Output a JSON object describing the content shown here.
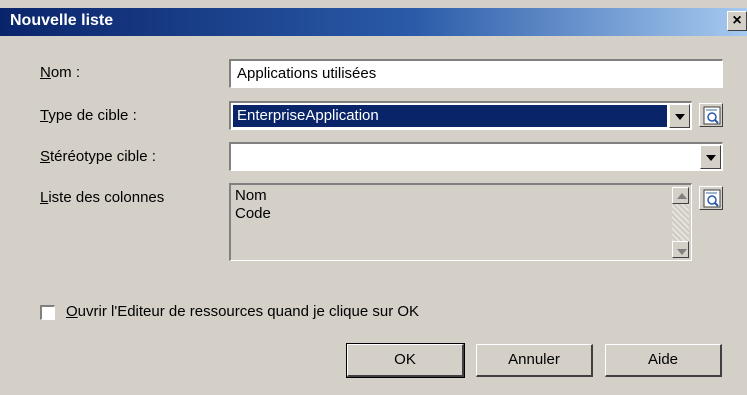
{
  "window": {
    "title": "Nouvelle liste",
    "close_label": "×"
  },
  "form": {
    "name": {
      "label_u": "N",
      "label_rest": "om :",
      "value": "Applications utilisées"
    },
    "target_type": {
      "label_u": "T",
      "label_rest": "ype de cible :",
      "value": "EnterpriseApplication",
      "icon": "properties-icon"
    },
    "target_stereotype": {
      "label_u": "S",
      "label_rest": "téréotype cible :",
      "value": ""
    },
    "columns": {
      "label_u": "L",
      "label_rest": "iste des colonnes",
      "items": [
        "Nom",
        "Code"
      ],
      "icon": "properties-icon"
    }
  },
  "open_editor": {
    "label_u": "O",
    "label_rest": "uvrir l'Editeur de ressources quand je clique sur OK",
    "checked": false
  },
  "buttons": {
    "ok": "OK",
    "cancel": "Annuler",
    "help": "Aide"
  }
}
